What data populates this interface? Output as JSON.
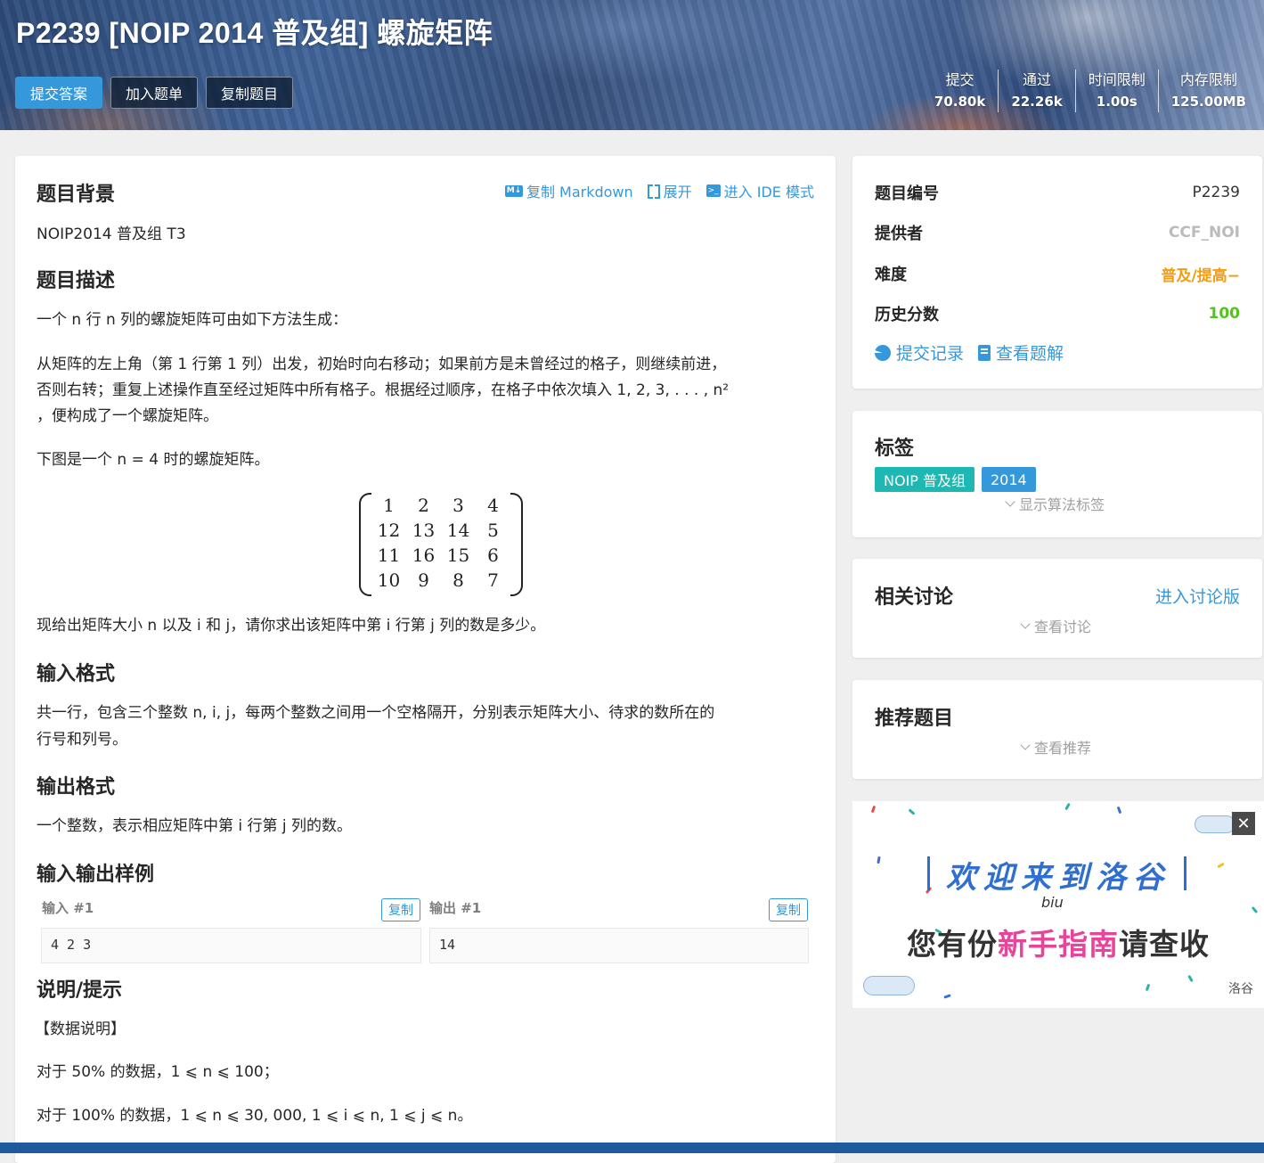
{
  "header": {
    "title": "P2239 [NOIP 2014 普及组] 螺旋矩阵",
    "buttons": {
      "submit": "提交答案",
      "add_list": "加入题单",
      "copy_problem": "复制题目"
    },
    "stats": [
      {
        "name": "提交",
        "value": "70.80k"
      },
      {
        "name": "通过",
        "value": "22.26k"
      },
      {
        "name": "时间限制",
        "value": "1.00s"
      },
      {
        "name": "内存限制",
        "value": "125.00MB"
      }
    ]
  },
  "main": {
    "links": {
      "copy_markdown": "复制 Markdown",
      "expand": "展开",
      "ide": "进入 IDE 模式",
      "md_icon": "M↓"
    },
    "background": {
      "title": "题目背景",
      "text": "NOIP2014 普及组 T3"
    },
    "description": {
      "title": "题目描述",
      "p1": "一个 n 行 n 列的螺旋矩阵可由如下方法生成：",
      "p2_line1": "从矩阵的左上角（第 1 行第 1 列）出发，初始时向右移动；如果前方是未曾经过的格子，则继续前进，",
      "p2_line2": "否则右转；重复上述操作直至经过矩阵中所有格子。根据经过顺序，在格子中依次填入 1, 2, 3, . . . , n²",
      "p2_line3": "，便构成了一个螺旋矩阵。",
      "p3": "下图是一个 n = 4 时的螺旋矩阵。",
      "matrix": [
        [
          1,
          2,
          3,
          4
        ],
        [
          12,
          13,
          14,
          5
        ],
        [
          11,
          16,
          15,
          6
        ],
        [
          10,
          9,
          8,
          7
        ]
      ],
      "p4": "现给出矩阵大小 n 以及 i 和 j，请你求出该矩阵中第 i 行第 j 列的数是多少。"
    },
    "input_format": {
      "title": "输入格式",
      "line1": "共一行，包含三个整数 n, i, j，每两个整数之间用一个空格隔开，分别表示矩阵大小、待求的数所在的",
      "line2": "行号和列号。"
    },
    "output_format": {
      "title": "输出格式",
      "text": "一个整数，表示相应矩阵中第 i 行第 j 列的数。"
    },
    "samples": {
      "title": "输入输出样例",
      "input_label": "输入 #1",
      "output_label": "输出 #1",
      "copy_label": "复制",
      "input": "4 2 3",
      "output": "14"
    },
    "hint": {
      "title": "说明/提示",
      "data_title": "【数据说明】",
      "line1": "对于 50% 的数据，1 ⩽ n ⩽ 100；",
      "line2": "对于 100% 的数据，1 ⩽ n ⩽ 30, 000, 1 ⩽ i ⩽ n, 1 ⩽ j ⩽ n。"
    }
  },
  "sidebar": {
    "info": {
      "id_label": "题目编号",
      "id_value": "P2239",
      "provider_label": "提供者",
      "provider_value": "CCF_NOI",
      "difficulty_label": "难度",
      "difficulty_value": "普及/提高−",
      "score_label": "历史分数",
      "score_value": "100",
      "records_link": "提交记录",
      "solutions_link": "查看题解"
    },
    "tags": {
      "title": "标签",
      "items": [
        {
          "label": "NOIP 普及组",
          "color": "#1fb7b1"
        },
        {
          "label": "2014",
          "color": "#3498db"
        }
      ],
      "show_algo": "显示算法标签"
    },
    "discuss": {
      "title": "相关讨论",
      "enter": "进入讨论版",
      "view": "查看讨论"
    },
    "recommend": {
      "title": "推荐题目",
      "view": "查看推荐"
    }
  },
  "ad": {
    "welcome": "欢迎来到洛谷",
    "biu": "biu",
    "line2_a": "您有份",
    "line2_b": "新手指南",
    "line2_c": "请查收",
    "corner": "洛谷",
    "close": "✕"
  },
  "colors": {
    "accent": "#3498db",
    "difficulty": "#f39c11",
    "score": "#52c41a",
    "provider": "#bbbbbb"
  }
}
